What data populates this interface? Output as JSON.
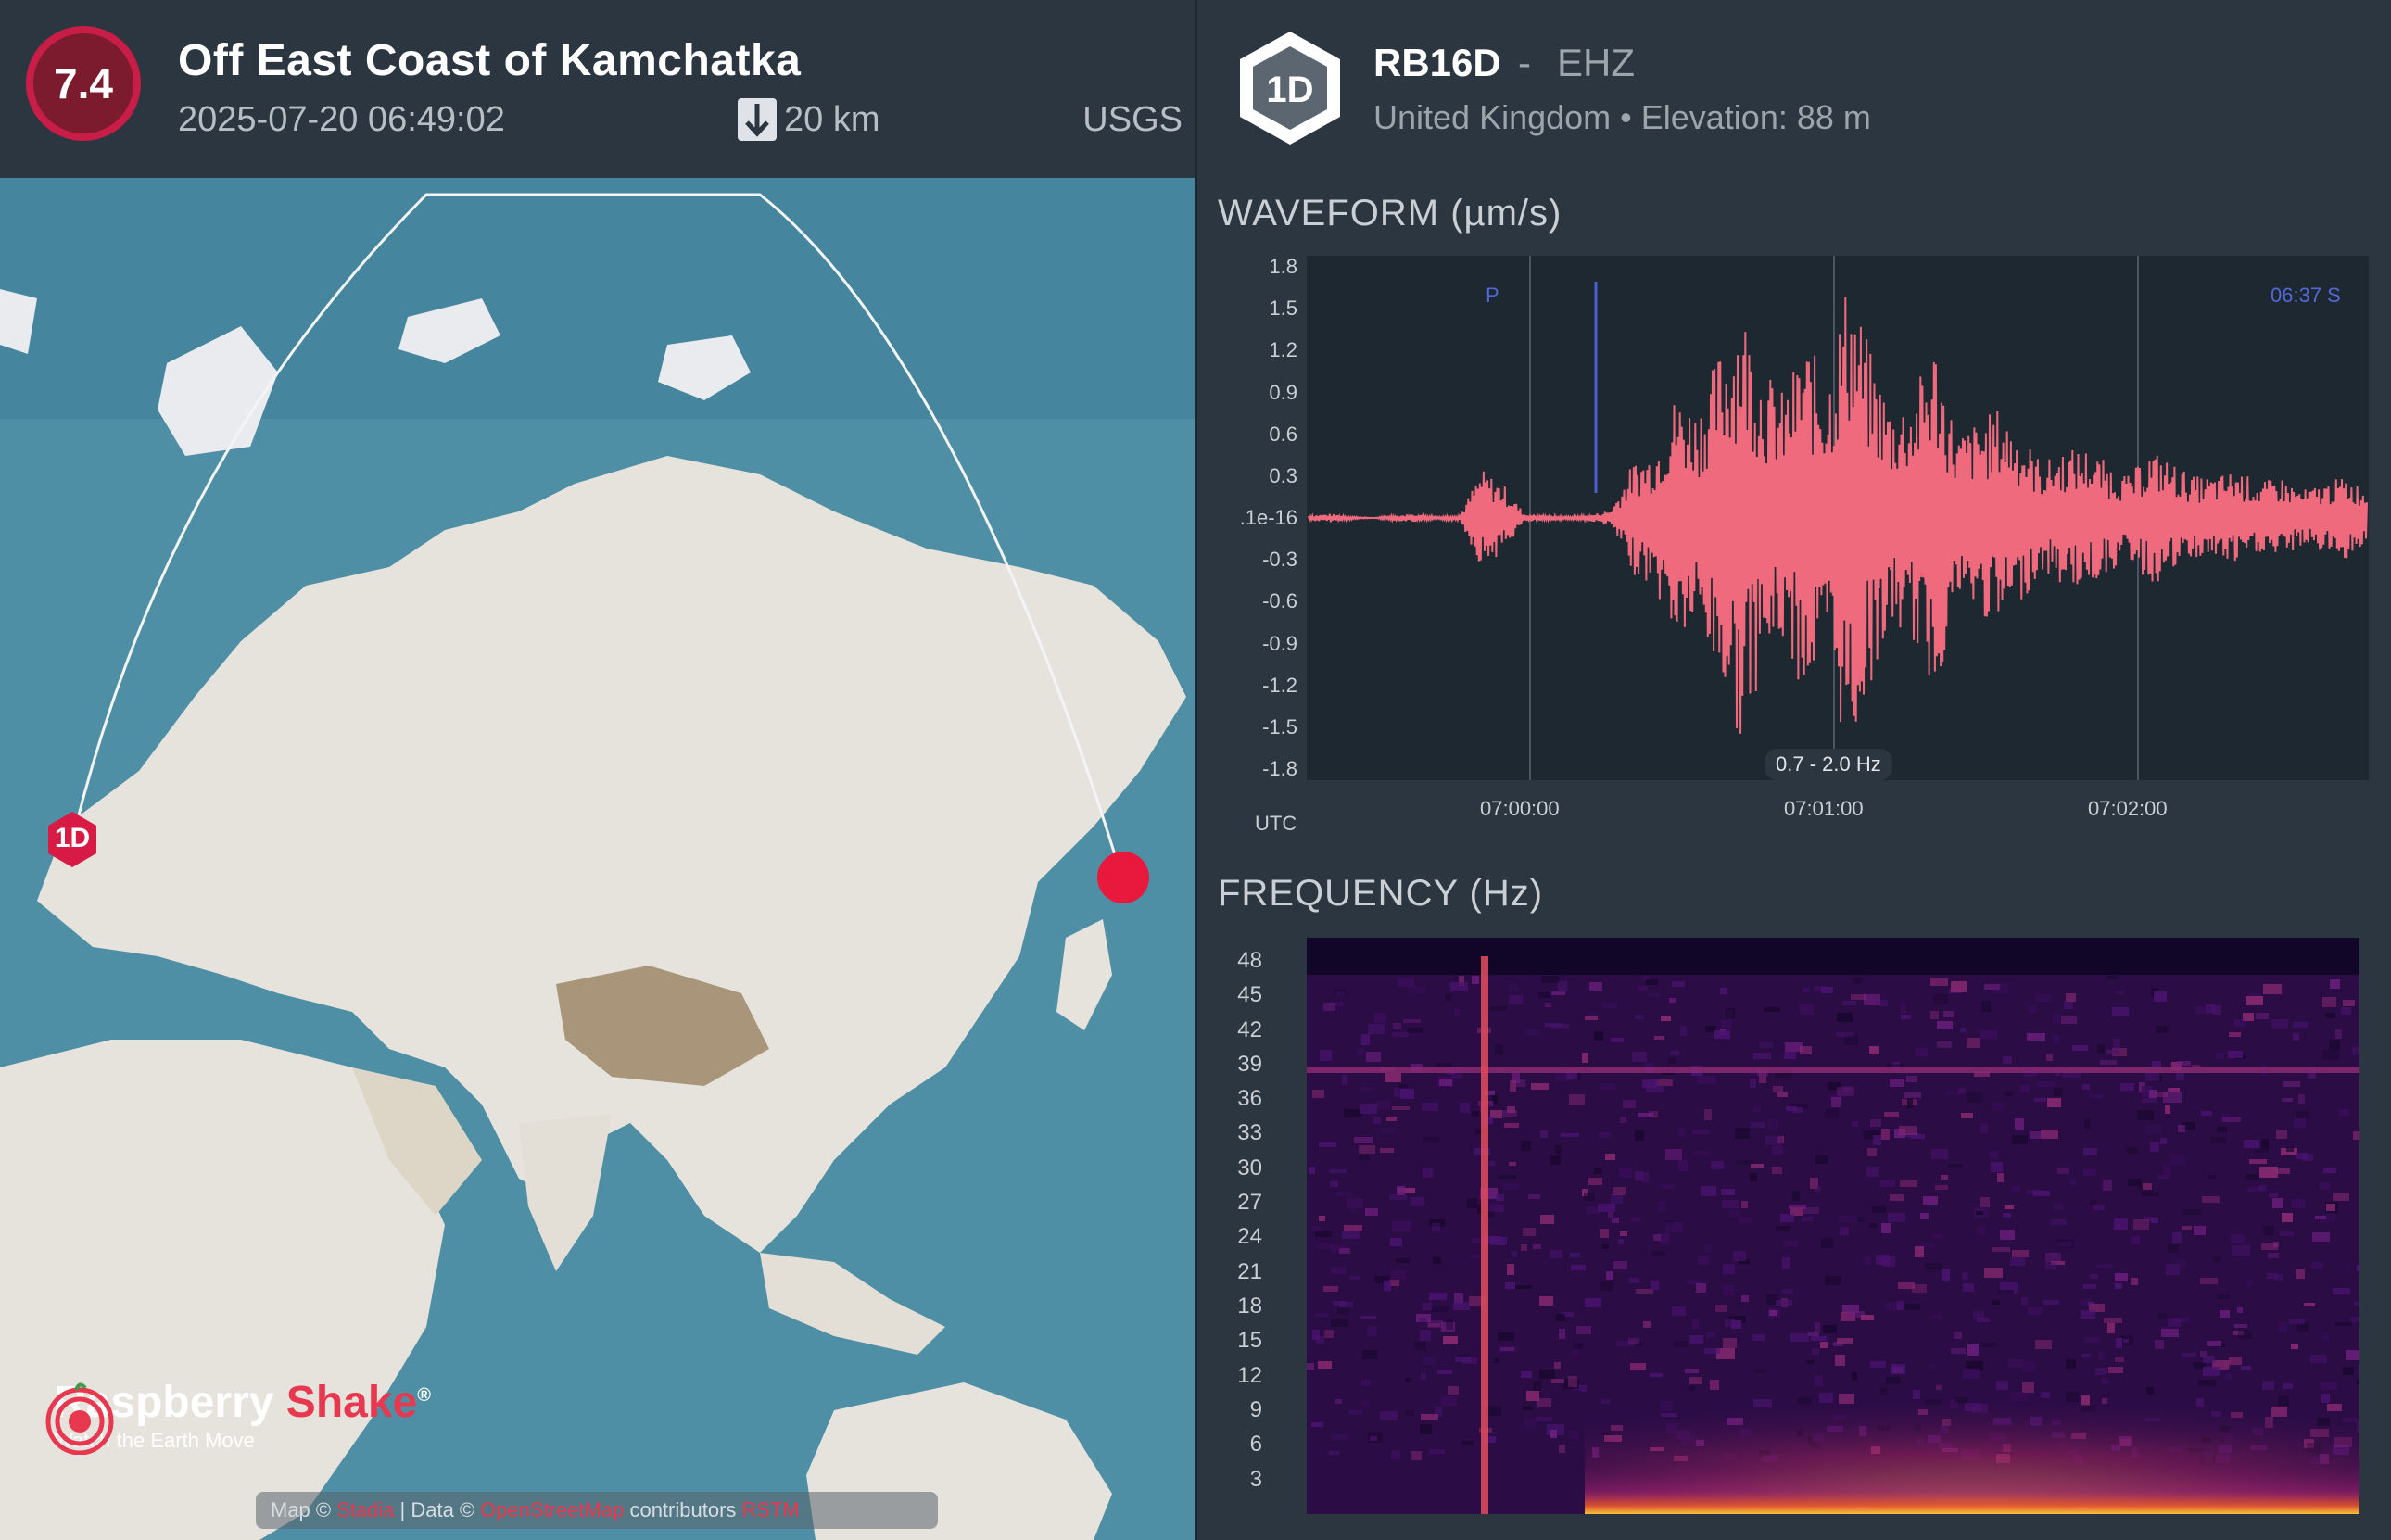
{
  "event": {
    "magnitude": "7.4",
    "title": "Off East Coast of Kamchatka",
    "time": "2025-07-20 06:49:02",
    "depth": "20 km",
    "agency": "USGS"
  },
  "map": {
    "station_marker": "1D",
    "attribution_prefix": "Map ©",
    "attribution_link1": "Stadia",
    "attribution_mid": "| Data ©",
    "attribution_link2": "OpenStreetMap",
    "attribution_suffix": "contributors",
    "attribution_link3": "RSTM",
    "logo_name_1": "Raspberry",
    "logo_name_2": "Shake",
    "logo_reg": "®",
    "logo_tagline": "Watch the Earth Move",
    "colors": {
      "ocean": "#4f8fa5",
      "land": "#e6e3dd",
      "event": "#e8193c",
      "station": "#d81b45"
    }
  },
  "station": {
    "badge": "1D",
    "code": "RB16D",
    "dash": "-",
    "channel": "EHZ",
    "location": "United Kingdom • Elevation: 88 m"
  },
  "waveform": {
    "title": "WAVEFORM (µm/s)",
    "utc_label": "UTC",
    "filter": "0.7 - 2.0 Hz",
    "p_label": "P",
    "s_label": "06:37  S",
    "color": "#f06a7e"
  },
  "frequency": {
    "title": "FREQUENCY (Hz)"
  },
  "chart_data": [
    {
      "type": "line",
      "title": "WAVEFORM (µm/s)",
      "ylabel": "µm/s",
      "xlabel": "UTC",
      "ylim": [
        -1.8,
        1.8
      ],
      "y_ticks": [
        "1.8",
        "1.5",
        "1.2",
        "0.9",
        "0.6",
        "0.3",
        ".1e-16",
        "-0.3",
        "-0.6",
        "-0.9",
        "-1.2",
        "-1.5",
        "-1.8"
      ],
      "x_ticks": [
        "07:00:00",
        "07:01:00",
        "07:02:00"
      ],
      "series": [
        {
          "values": [
            0.02,
            -0.03,
            0.01,
            0.0,
            -0.02,
            0.03,
            -0.01,
            0.02,
            -0.35,
            0.25,
            0.03,
            -0.02,
            0.01,
            0.02,
            0.06,
            0.4,
            -0.5,
            0.9,
            -0.8,
            1.2,
            -1.6,
            1.1,
            -0.9,
            1.3,
            -1.0,
            1.8,
            -1.2,
            0.8,
            -0.9,
            1.3,
            -0.6,
            0.7,
            -0.8,
            0.6,
            -0.4,
            0.5,
            -0.5,
            0.4,
            -0.3,
            0.5,
            -0.4,
            0.3,
            -0.3,
            0.35,
            -0.25,
            0.3,
            -0.2,
            0.25,
            -0.3,
            0.2
          ]
        }
      ]
    },
    {
      "type": "heatmap",
      "title": "FREQUENCY (Hz)",
      "ylabel": "Hz",
      "ylim": [
        0,
        50
      ],
      "y_ticks": [
        "48",
        "45",
        "42",
        "39",
        "36",
        "33",
        "30",
        "27",
        "24",
        "21",
        "18",
        "15",
        "12",
        "9",
        "6",
        "3"
      ]
    }
  ]
}
